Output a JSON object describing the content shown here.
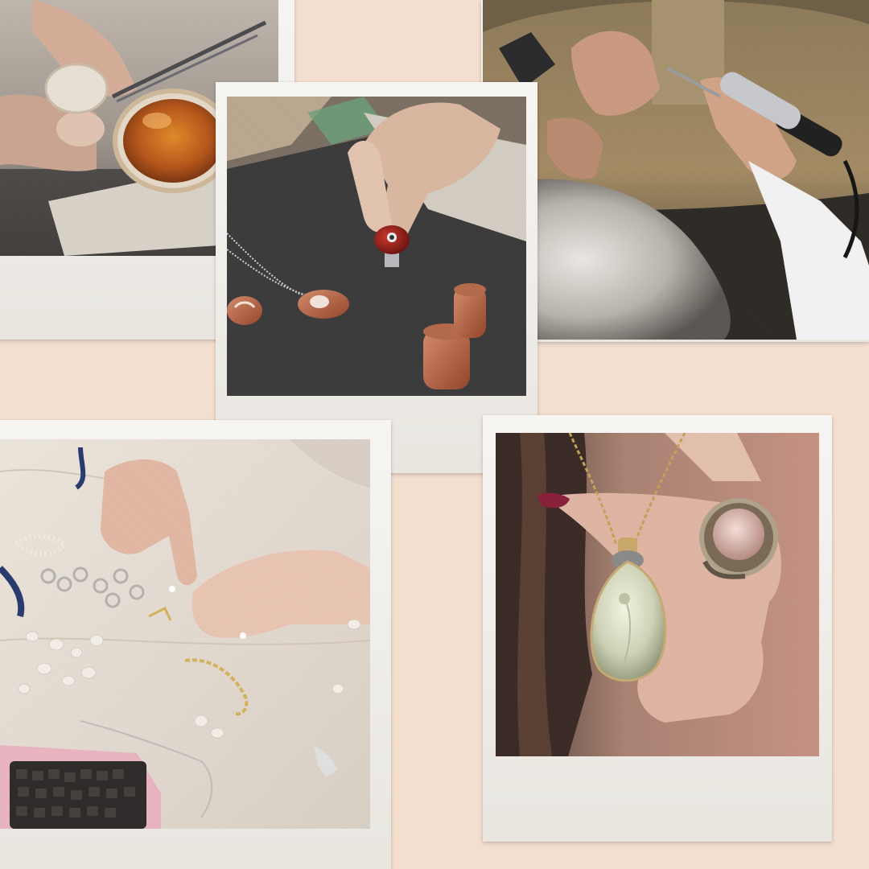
{
  "colors": {
    "background": "#f4dfcf",
    "polaroid_frame": "#f6f5f2",
    "polaroid_edge": "#e9e6e0"
  },
  "photos": [
    {
      "subject": "hand-with-tweezers-setting-amber-stone"
    },
    {
      "subject": "hand-holding-red-ring-on-workbench"
    },
    {
      "subject": "jeweler-using-rotary-tool"
    },
    {
      "subject": "hands-arranging-jewelry-pieces"
    },
    {
      "subject": "hand-with-crystal-pendant-and-ring"
    }
  ]
}
